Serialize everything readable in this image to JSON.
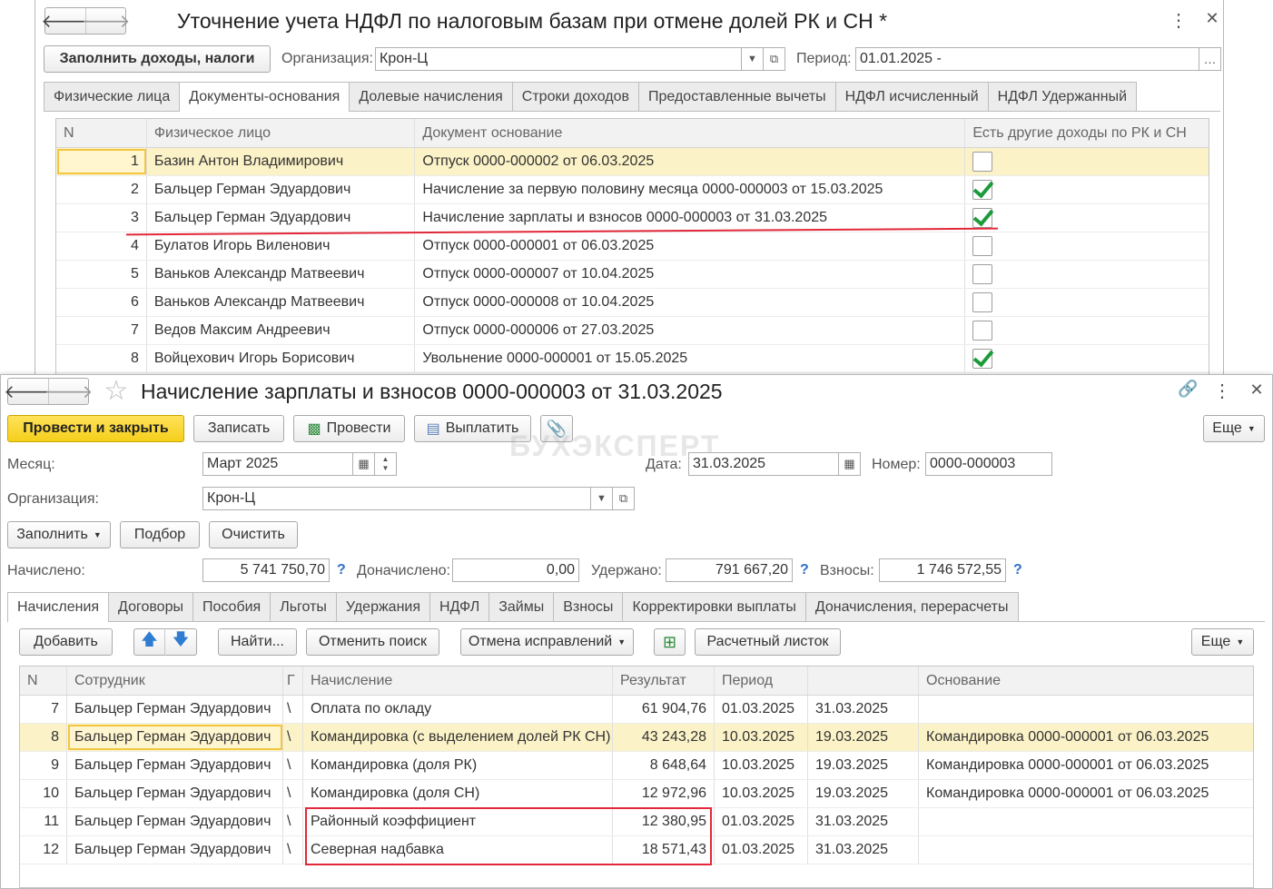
{
  "window1": {
    "title": "Уточнение учета НДФЛ по налоговым базам при отмене долей РК и СН *",
    "fill_button": "Заполнить доходы, налоги",
    "org_label": "Организация:",
    "org_value": "Крон-Ц",
    "period_label": "Период:",
    "period_value": "01.01.2025 -",
    "tabs": [
      "Физические лица",
      "Документы-основания",
      "Долевые начисления",
      "Строки доходов",
      "Предоставленные вычеты",
      "НДФЛ исчисленный",
      "НДФЛ Удержанный"
    ],
    "active_tab": "Документы-основания",
    "columns": [
      "N",
      "Физическое лицо",
      "Документ основание",
      "Есть другие доходы по РК и СН"
    ],
    "rows": [
      {
        "n": "1",
        "person": "Базин Антон Владимирович",
        "doc": "Отпуск 0000-000002 от 06.03.2025",
        "other": false
      },
      {
        "n": "2",
        "person": "Бальцер Герман Эдуардович",
        "doc": "Начисление за первую половину месяца 0000-000003 от 15.03.2025",
        "other": true
      },
      {
        "n": "3",
        "person": "Бальцер Герман Эдуардович",
        "doc": "Начисление зарплаты и взносов 0000-000003 от 31.03.2025",
        "other": true
      },
      {
        "n": "4",
        "person": "Булатов Игорь Виленович",
        "doc": "Отпуск 0000-000001 от 06.03.2025",
        "other": false
      },
      {
        "n": "5",
        "person": "Ваньков Александр Матвеевич",
        "doc": "Отпуск 0000-000007 от 10.04.2025",
        "other": false
      },
      {
        "n": "6",
        "person": "Ваньков Александр Матвеевич",
        "doc": "Отпуск 0000-000008 от 10.04.2025",
        "other": false
      },
      {
        "n": "7",
        "person": "Ведов Максим Андреевич",
        "doc": "Отпуск 0000-000006 от 27.03.2025",
        "other": false
      },
      {
        "n": "8",
        "person": "Войцехович Игорь Борисович",
        "doc": "Увольнение 0000-000001 от 15.05.2025",
        "other": true
      }
    ]
  },
  "window2": {
    "title": "Начисление зарплаты и взносов 0000-000003 от 31.03.2025",
    "toolbar": {
      "post_close": "Провести и закрыть",
      "save": "Записать",
      "post": "Провести",
      "pay": "Выплатить",
      "more": "Еще"
    },
    "watermark": "БУХЭКСПЕРТ",
    "month_label": "Месяц:",
    "month_value": "Март 2025",
    "date_label": "Дата:",
    "date_value": "31.03.2025",
    "number_label": "Номер:",
    "number_value": "0000-000003",
    "org_label": "Организация:",
    "org_value": "Крон-Ц",
    "fill_button": "Заполнить",
    "pick_button": "Подбор",
    "clear_button": "Очистить",
    "accrued_label": "Начислено:",
    "accrued_value": "5 741 750,70",
    "extra_label": "Доначислено:",
    "extra_value": "0,00",
    "withheld_label": "Удержано:",
    "withheld_value": "791 667,20",
    "contrib_label": "Взносы:",
    "contrib_value": "1 746 572,55",
    "help": "?",
    "tabs": [
      "Начисления",
      "Договоры",
      "Пособия",
      "Льготы",
      "Удержания",
      "НДФЛ",
      "Займы",
      "Взносы",
      "Корректировки выплаты",
      "Доначисления, перерасчеты"
    ],
    "active_tab": "Начисления",
    "grid_toolbar": {
      "add": "Добавить",
      "find": "Найти...",
      "cancel_search": "Отменить поиск",
      "cancel_fix": "Отмена исправлений",
      "payslip": "Расчетный листок",
      "more": "Еще"
    },
    "columns": [
      "N",
      "Сотрудник",
      "Г",
      "Начисление",
      "Результат",
      "Период",
      "",
      "Основание"
    ],
    "rows": [
      {
        "n": "7",
        "employee": "Бальцер Герман Эдуардович",
        "g": "\\",
        "accrual": "Оплата по окладу",
        "result": "61 904,76",
        "from": "01.03.2025",
        "to": "31.03.2025",
        "basis": ""
      },
      {
        "n": "8",
        "employee": "Бальцер Герман Эдуардович",
        "g": "\\",
        "accrual": "Командировка (с выделением долей РК СН)",
        "result": "43 243,28",
        "from": "10.03.2025",
        "to": "19.03.2025",
        "basis": "Командировка 0000-000001 от 06.03.2025"
      },
      {
        "n": "9",
        "employee": "Бальцер Герман Эдуардович",
        "g": "\\",
        "accrual": "Командировка (доля РК)",
        "result": "8 648,64",
        "from": "10.03.2025",
        "to": "19.03.2025",
        "basis": "Командировка 0000-000001 от 06.03.2025"
      },
      {
        "n": "10",
        "employee": "Бальцер Герман Эдуардович",
        "g": "\\",
        "accrual": "Командировка (доля СН)",
        "result": "12 972,96",
        "from": "10.03.2025",
        "to": "19.03.2025",
        "basis": "Командировка 0000-000001 от 06.03.2025"
      },
      {
        "n": "11",
        "employee": "Бальцер Герман Эдуардович",
        "g": "\\",
        "accrual": "Районный коэффициент",
        "result": "12 380,95",
        "from": "01.03.2025",
        "to": "31.03.2025",
        "basis": ""
      },
      {
        "n": "12",
        "employee": "Бальцер Герман Эдуардович",
        "g": "\\",
        "accrual": "Северная надбавка",
        "result": "18 571,43",
        "from": "01.03.2025",
        "to": "31.03.2025",
        "basis": ""
      }
    ]
  },
  "colors": {
    "accent_yellow": "#f5cf1b",
    "selection": "#fbf2c7",
    "highlight_red": "#e2283a",
    "check_green": "#1c9b3b"
  }
}
